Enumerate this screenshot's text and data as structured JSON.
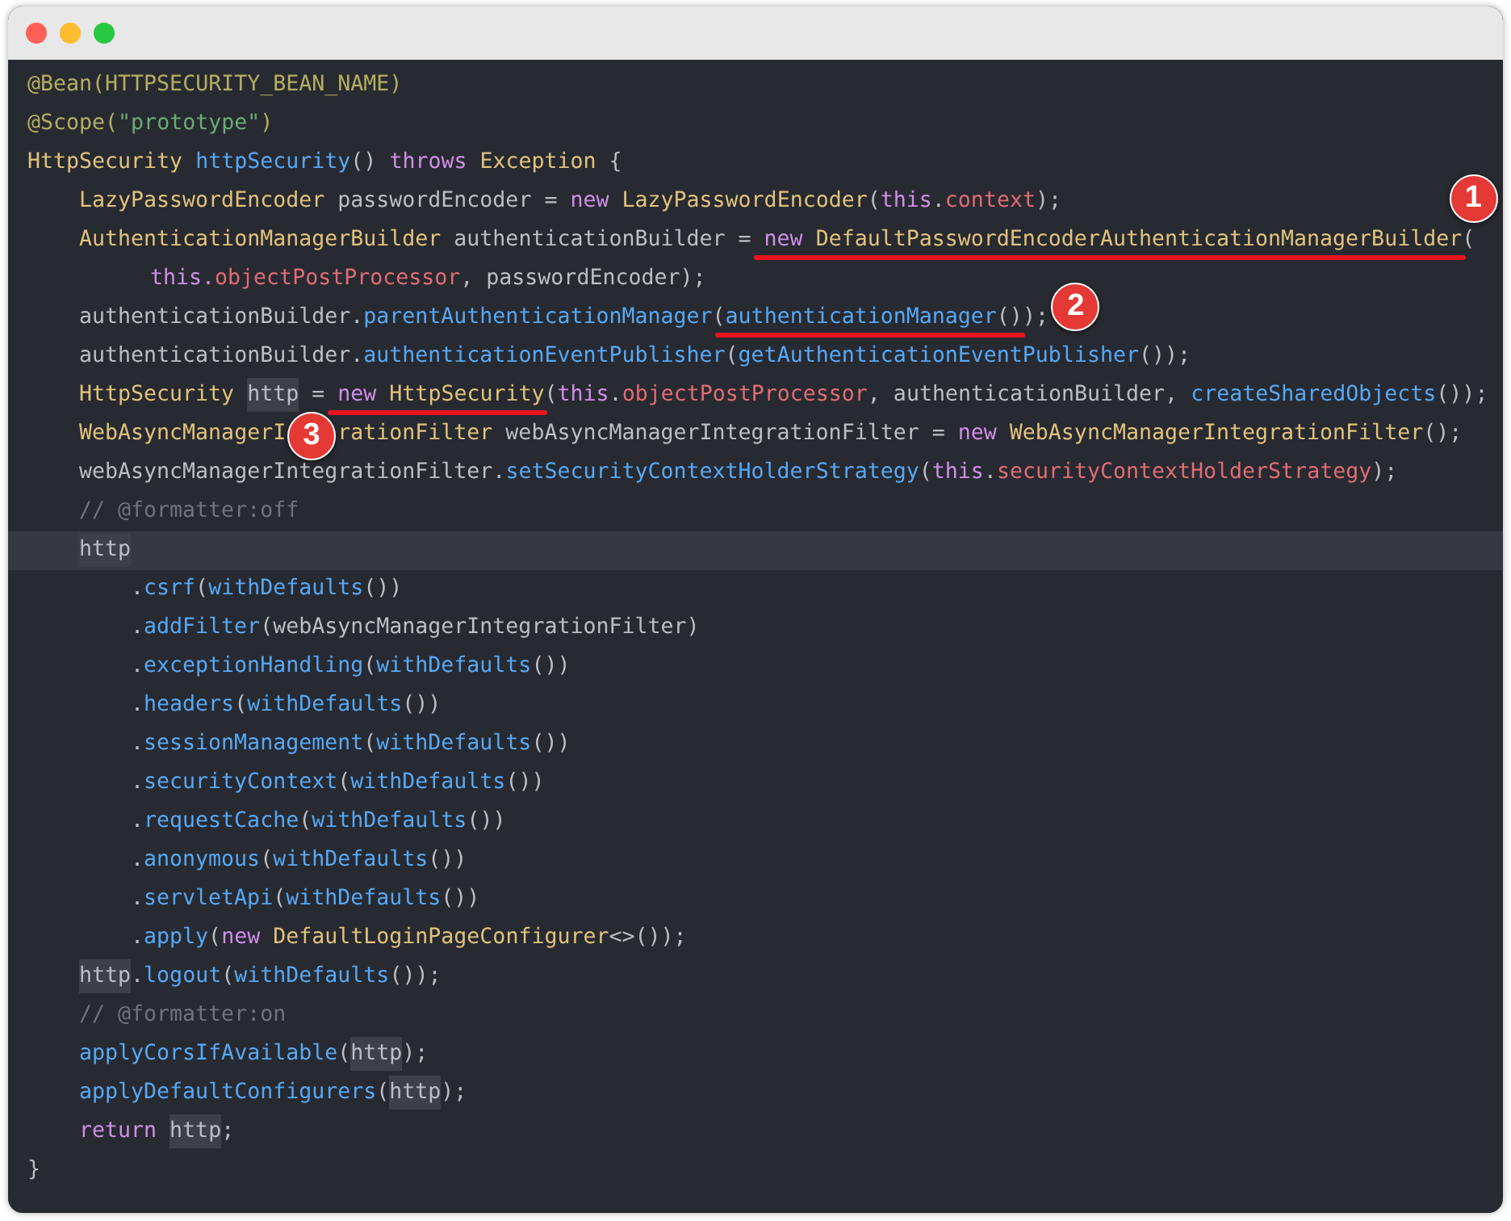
{
  "window": {
    "controls": [
      {
        "kind": "close"
      },
      {
        "kind": "minimize"
      },
      {
        "kind": "zoom"
      }
    ]
  },
  "code": [
    {
      "current": false,
      "tokens": [
        {
          "kind": "annotation",
          "text": "@Bean(HTTPSECURITY_BEAN_NAME)"
        }
      ]
    },
    {
      "current": false,
      "tokens": [
        {
          "kind": "annotation",
          "text": "@Scope("
        },
        {
          "kind": "string",
          "text": "\"prototype\""
        },
        {
          "kind": "annotation",
          "text": ")"
        }
      ]
    },
    {
      "current": false,
      "tokens": [
        {
          "kind": "type",
          "text": "HttpSecurity"
        },
        {
          "kind": "method",
          "text": " httpSecurity"
        },
        {
          "kind": "plain",
          "text": "() "
        },
        {
          "kind": "keyword",
          "text": "throws "
        },
        {
          "kind": "type",
          "text": "Exception"
        },
        {
          "kind": "plain",
          "text": " {"
        }
      ],
      "children": [
        {
          "current": false,
          "tokens": [
            {
              "kind": "type",
              "text": "LazyPasswordEncoder"
            },
            {
              "kind": "plain",
              "text": " passwordEncoder = "
            },
            {
              "kind": "keyword",
              "text": "new "
            },
            {
              "kind": "type",
              "text": "LazyPasswordEncoder"
            },
            {
              "kind": "plain",
              "text": "("
            },
            {
              "kind": "keyword",
              "text": "this"
            },
            {
              "kind": "plain",
              "text": "."
            },
            {
              "kind": "field",
              "text": "context"
            },
            {
              "kind": "plain",
              "text": ");"
            }
          ]
        },
        {
          "current": false,
          "tokens": [
            {
              "kind": "type",
              "text": "AuthenticationManagerBuilder"
            },
            {
              "kind": "plain",
              "text": " authenticationBuilder = "
            },
            {
              "kind": "mark",
              "badge": {
                "kind": "above",
                "text": "1"
              },
              "tokens": [
                {
                  "kind": "keyword",
                  "text": "new "
                },
                {
                  "kind": "type",
                  "text": "DefaultPasswordEncoderAuthenticationManagerBuilder"
                }
              ]
            },
            {
              "kind": "plain",
              "text": "("
            }
          ],
          "children": [
            {
              "current": false,
              "kind": "continuation",
              "tokens": [
                {
                  "kind": "keyword",
                  "text": "this."
                },
                {
                  "kind": "field",
                  "text": "objectPostProcessor"
                },
                {
                  "kind": "plain",
                  "text": ", passwordEncoder);"
                }
              ]
            }
          ]
        },
        {
          "current": false,
          "tokens": [
            {
              "kind": "plain",
              "text": "authenticationBuilder."
            },
            {
              "kind": "method",
              "text": "parentAuthenticationManager"
            },
            {
              "kind": "plain",
              "text": "("
            },
            {
              "kind": "mark",
              "badge": {
                "kind": "beside",
                "text": "2"
              },
              "tokens": [
                {
                  "kind": "method",
                  "text": "authenticationManager"
                },
                {
                  "kind": "plain",
                  "text": "()"
                }
              ]
            },
            {
              "kind": "plain",
              "text": ");"
            }
          ]
        },
        {
          "current": false,
          "tokens": [
            {
              "kind": "plain",
              "text": "authenticationBuilder."
            },
            {
              "kind": "method",
              "text": "authenticationEventPublisher"
            },
            {
              "kind": "plain",
              "text": "("
            },
            {
              "kind": "method",
              "text": "getAuthenticationEventPublisher"
            },
            {
              "kind": "plain",
              "text": "());"
            }
          ]
        },
        {
          "current": false,
          "tokens": [
            {
              "kind": "type",
              "text": "HttpSecurity "
            },
            {
              "kind": "usage",
              "text": "http"
            },
            {
              "kind": "plain",
              "text": " = "
            },
            {
              "kind": "mark",
              "tokens": [
                {
                  "kind": "keyword",
                  "text": "new "
                },
                {
                  "kind": "type",
                  "text": "HttpSecurity"
                }
              ]
            },
            {
              "kind": "plain",
              "text": "("
            },
            {
              "kind": "keyword",
              "text": "this"
            },
            {
              "kind": "plain",
              "text": "."
            },
            {
              "kind": "field",
              "text": "objectPostProcessor"
            },
            {
              "kind": "plain",
              "text": ", authenticationBuilder, "
            },
            {
              "kind": "method",
              "text": "createSharedObjects"
            },
            {
              "kind": "plain",
              "text": "());"
            }
          ]
        },
        {
          "current": false,
          "tokens": [
            {
              "kind": "type",
              "text": "WebAsyncManagerI"
            },
            {
              "kind": "badge",
              "text": "3"
            },
            {
              "kind": "type",
              "text": "rationFilter"
            },
            {
              "kind": "plain",
              "text": " webAsyncManagerIntegrationFilter = "
            },
            {
              "kind": "keyword",
              "text": "new "
            },
            {
              "kind": "type",
              "text": "WebAsyncManagerIntegrationFilter"
            },
            {
              "kind": "plain",
              "text": "();"
            }
          ]
        },
        {
          "current": false,
          "tokens": [
            {
              "kind": "plain",
              "text": "webAsyncManagerIntegrationFilter."
            },
            {
              "kind": "method",
              "text": "setSecurityContextHolderStrategy"
            },
            {
              "kind": "plain",
              "text": "("
            },
            {
              "kind": "keyword",
              "text": "this"
            },
            {
              "kind": "plain",
              "text": "."
            },
            {
              "kind": "field",
              "text": "securityContextHolderStrategy"
            },
            {
              "kind": "plain",
              "text": ");"
            }
          ]
        },
        {
          "current": false,
          "tokens": [
            {
              "kind": "comment",
              "text": "// @formatter:off"
            }
          ]
        },
        {
          "current": true,
          "tokens": [
            {
              "kind": "usage",
              "text": "http"
            }
          ],
          "children": [
            {
              "current": false,
              "tokens": [
                {
                  "kind": "plain",
                  "text": "."
                },
                {
                  "kind": "method",
                  "text": "csrf"
                },
                {
                  "kind": "plain",
                  "text": "("
                },
                {
                  "kind": "method",
                  "text": "withDefaults"
                },
                {
                  "kind": "plain",
                  "text": "())"
                }
              ]
            },
            {
              "current": false,
              "tokens": [
                {
                  "kind": "plain",
                  "text": "."
                },
                {
                  "kind": "method",
                  "text": "addFilter"
                },
                {
                  "kind": "plain",
                  "text": "(webAsyncManagerIntegrationFilter)"
                }
              ]
            },
            {
              "current": false,
              "tokens": [
                {
                  "kind": "plain",
                  "text": "."
                },
                {
                  "kind": "method",
                  "text": "exceptionHandling"
                },
                {
                  "kind": "plain",
                  "text": "("
                },
                {
                  "kind": "method",
                  "text": "withDefaults"
                },
                {
                  "kind": "plain",
                  "text": "())"
                }
              ]
            },
            {
              "current": false,
              "tokens": [
                {
                  "kind": "plain",
                  "text": "."
                },
                {
                  "kind": "method",
                  "text": "headers"
                },
                {
                  "kind": "plain",
                  "text": "("
                },
                {
                  "kind": "method",
                  "text": "withDefaults"
                },
                {
                  "kind": "plain",
                  "text": "())"
                }
              ]
            },
            {
              "current": false,
              "tokens": [
                {
                  "kind": "plain",
                  "text": "."
                },
                {
                  "kind": "method",
                  "text": "sessionManagement"
                },
                {
                  "kind": "plain",
                  "text": "("
                },
                {
                  "kind": "method",
                  "text": "withDefaults"
                },
                {
                  "kind": "plain",
                  "text": "())"
                }
              ]
            },
            {
              "current": false,
              "tokens": [
                {
                  "kind": "plain",
                  "text": "."
                },
                {
                  "kind": "method",
                  "text": "securityContext"
                },
                {
                  "kind": "plain",
                  "text": "("
                },
                {
                  "kind": "method",
                  "text": "withDefaults"
                },
                {
                  "kind": "plain",
                  "text": "())"
                }
              ]
            },
            {
              "current": false,
              "tokens": [
                {
                  "kind": "plain",
                  "text": "."
                },
                {
                  "kind": "method",
                  "text": "requestCache"
                },
                {
                  "kind": "plain",
                  "text": "("
                },
                {
                  "kind": "method",
                  "text": "withDefaults"
                },
                {
                  "kind": "plain",
                  "text": "())"
                }
              ]
            },
            {
              "current": false,
              "tokens": [
                {
                  "kind": "plain",
                  "text": "."
                },
                {
                  "kind": "method",
                  "text": "anonymous"
                },
                {
                  "kind": "plain",
                  "text": "("
                },
                {
                  "kind": "method",
                  "text": "withDefaults"
                },
                {
                  "kind": "plain",
                  "text": "())"
                }
              ]
            },
            {
              "current": false,
              "tokens": [
                {
                  "kind": "plain",
                  "text": "."
                },
                {
                  "kind": "method",
                  "text": "servletApi"
                },
                {
                  "kind": "plain",
                  "text": "("
                },
                {
                  "kind": "method",
                  "text": "withDefaults"
                },
                {
                  "kind": "plain",
                  "text": "())"
                }
              ]
            },
            {
              "current": false,
              "tokens": [
                {
                  "kind": "plain",
                  "text": "."
                },
                {
                  "kind": "method",
                  "text": "apply"
                },
                {
                  "kind": "plain",
                  "text": "("
                },
                {
                  "kind": "keyword",
                  "text": "new "
                },
                {
                  "kind": "type",
                  "text": "DefaultLoginPageConfigurer"
                },
                {
                  "kind": "plain",
                  "text": "<>());"
                }
              ]
            }
          ]
        },
        {
          "current": false,
          "tokens": [
            {
              "kind": "usage",
              "text": "http"
            },
            {
              "kind": "plain",
              "text": "."
            },
            {
              "kind": "method",
              "text": "logout"
            },
            {
              "kind": "plain",
              "text": "("
            },
            {
              "kind": "method",
              "text": "withDefaults"
            },
            {
              "kind": "plain",
              "text": "());"
            }
          ]
        },
        {
          "current": false,
          "tokens": [
            {
              "kind": "comment",
              "text": "// @formatter:on"
            }
          ]
        },
        {
          "current": false,
          "tokens": [
            {
              "kind": "method",
              "text": "applyCorsIfAvailable"
            },
            {
              "kind": "plain",
              "text": "("
            },
            {
              "kind": "usage",
              "text": "http"
            },
            {
              "kind": "plain",
              "text": ");"
            }
          ]
        },
        {
          "current": false,
          "tokens": [
            {
              "kind": "method",
              "text": "applyDefaultConfigurers"
            },
            {
              "kind": "plain",
              "text": "("
            },
            {
              "kind": "usage",
              "text": "http"
            },
            {
              "kind": "plain",
              "text": ");"
            }
          ]
        },
        {
          "current": false,
          "tokens": [
            {
              "kind": "keyword",
              "text": "return "
            },
            {
              "kind": "usage",
              "text": "http"
            },
            {
              "kind": "plain",
              "text": ";"
            }
          ]
        }
      ]
    },
    {
      "current": false,
      "tokens": [
        {
          "kind": "plain",
          "text": "}"
        }
      ]
    }
  ]
}
